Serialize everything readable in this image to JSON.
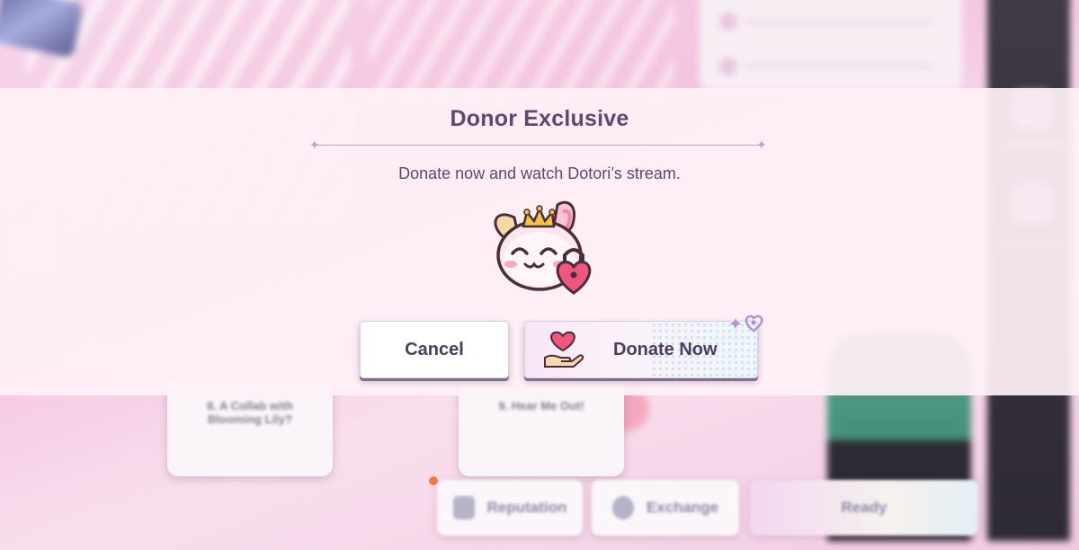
{
  "background": {
    "cards": [
      {
        "text": "8. A Collab with Blooming Lily?"
      },
      {
        "text": "9. Hear Me Out!"
      }
    ],
    "bottom_bar": {
      "reputation_label": "Reputation",
      "exchange_label": "Exchange",
      "ready_label": "Ready"
    }
  },
  "modal": {
    "title": "Donor Exclusive",
    "message": "Donate now and watch Dotori’s stream.",
    "cancel_label": "Cancel",
    "donate_label": "Donate Now"
  },
  "colors": {
    "text": "#5a4a6e",
    "modal_bg": "#fff0f6",
    "heart": "#f0567e",
    "button_border": "#7d6d8f"
  }
}
